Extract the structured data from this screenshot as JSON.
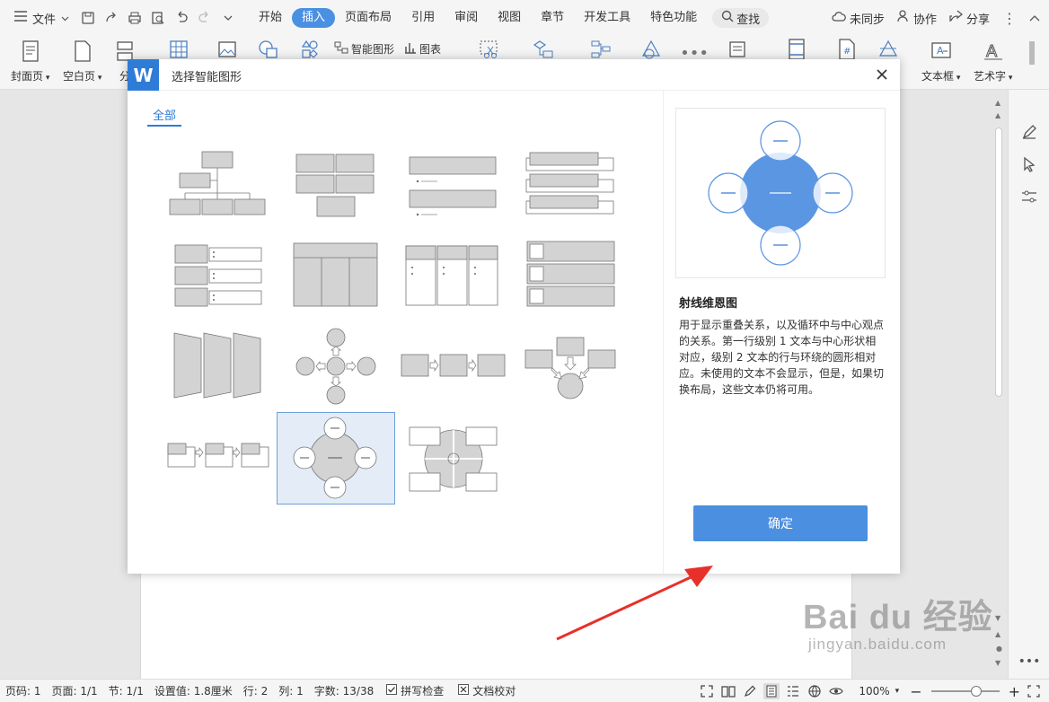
{
  "menubar": {
    "file_label": "文件",
    "tabs": [
      {
        "label": "开始"
      },
      {
        "label": "插入"
      },
      {
        "label": "页面布局"
      },
      {
        "label": "引用"
      },
      {
        "label": "审阅"
      },
      {
        "label": "视图"
      },
      {
        "label": "章节"
      },
      {
        "label": "开发工具"
      },
      {
        "label": "特色功能"
      }
    ],
    "active_tab": "插入",
    "search_label": "查找",
    "sync_label": "未同步",
    "collab_label": "协作",
    "share_label": "分享"
  },
  "ribbon": {
    "cover_page": "封面页",
    "blank_page": "空白页",
    "section": "分",
    "smart_art": "智能图形",
    "chart": "图表",
    "text_box": "文本框",
    "art_text": "艺术字"
  },
  "dialog": {
    "logo": "W",
    "title": "选择智能图形",
    "category_all": "全部",
    "preview": {
      "name": "射线维恩图",
      "description": "用于显示重叠关系，以及循环中与中心观点的关系。第一行级别 1 文本与中心形状相对应，级别 2 文本的行与环绕的圆形相对应。未使用的文本不会显示，但是，如果切换布局，这些文本仍将可用。"
    },
    "ok_label": "确定"
  },
  "statusbar": {
    "page_no": "页码: 1",
    "page": "页面: 1/1",
    "section": "节: 1/1",
    "setting": "设置值: 1.8厘米",
    "row": "行: 2",
    "col": "列: 1",
    "words": "字数: 13/38",
    "spell_check": "拼写检查",
    "doc_proof": "文档校对",
    "zoom": "100%"
  },
  "watermark": {
    "main": "Bai du 经验",
    "sub": "jingyan.baidu.com"
  },
  "colors": {
    "accent": "#4a90e2",
    "dialog_logo": "#2f7bd8",
    "ok_button": "#4b8fe0",
    "preview_circle": "#5b96e3",
    "thumb_gray": "#d3d3d3",
    "arrow": "#e8302a"
  }
}
